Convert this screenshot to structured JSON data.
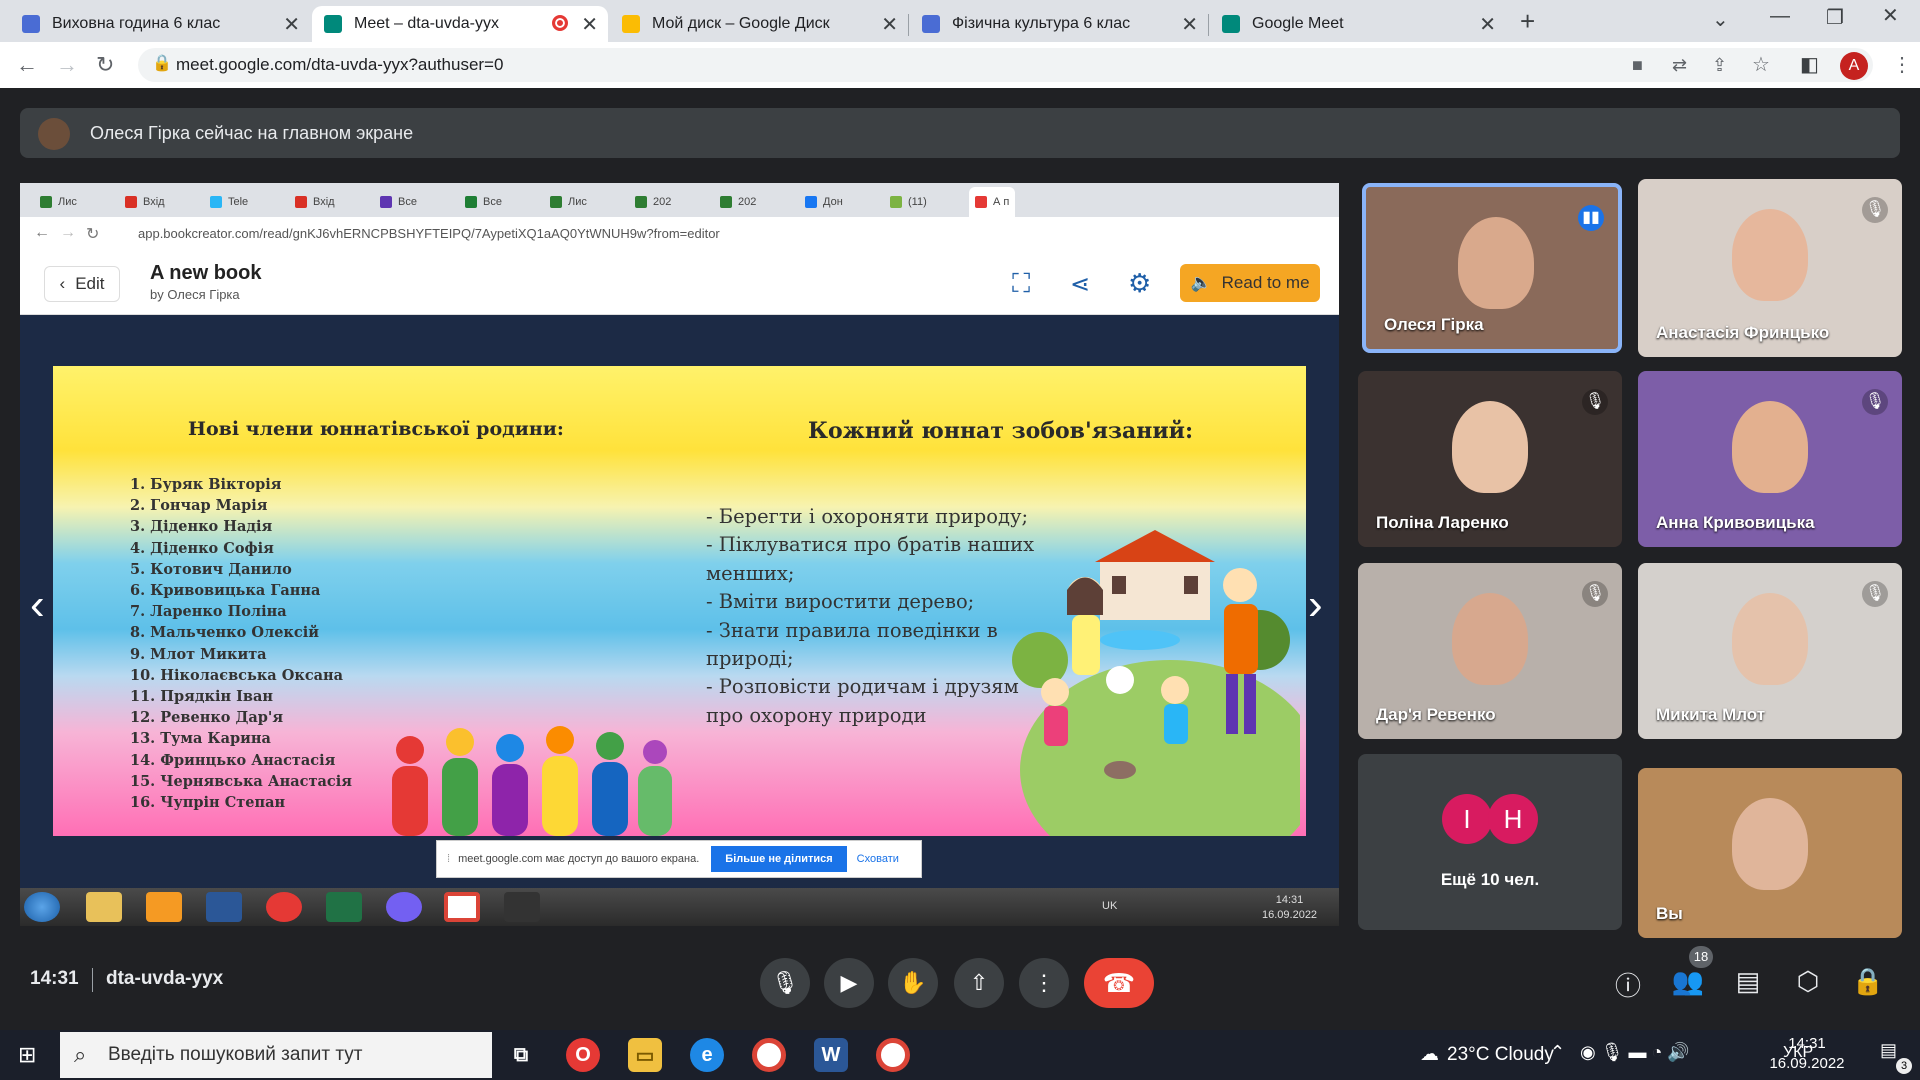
{
  "browser": {
    "tabs": [
      {
        "title": "Виховна година 6 клас",
        "color": "#4a6cd4"
      },
      {
        "title": "Meet – dta-uvda-yyx",
        "color": "#00897b"
      },
      {
        "title": "Мой диск – Google Диск",
        "color": "#fbbc04"
      },
      {
        "title": "Фізична культура 6 клас",
        "color": "#4a6cd4"
      },
      {
        "title": "Google Meet",
        "color": "#00897b"
      }
    ],
    "url": "meet.google.com/dta-uvda-yyx?authuser=0",
    "profile_initial": "A"
  },
  "meet": {
    "banner": "Олеся Гірка сейчас на главном экране",
    "shared": {
      "inner_url": "app.bookcreator.com/read/gnKJ6vhERNCPBSHYFTEIPQ/7AypetiXQ1aAQ0YtWNUH9w?from=editor",
      "inner_tabs": [
        "Лис",
        "Вхід",
        "Tele",
        "Вхід",
        "Всe",
        "Всe",
        "Лис",
        "202",
        "202",
        "Дон",
        "(11)",
        "А п"
      ],
      "edit_label": "Edit",
      "book_title": "A new book",
      "book_by": "by Олеся Гірка",
      "read_label": "Read to me",
      "slide": {
        "left_title": "Нові члени юннатівської родини:",
        "right_title": "Кожний юннат зобов'язаний:",
        "names": [
          "1.   Буряк Вікторія",
          "2.   Гончар Марія",
          "3.   Діденко Надія",
          "4.   Діденко Софія",
          "5.   Котович Данило",
          "6.   Кривовицька Ганна",
          "7.   Ларенко Поліна",
          "8.   Мальченко Олексій",
          "9.   Млот Микита",
          "10.  Ніколаєвська Оксана",
          "11.  Прядкін Іван",
          "12.  Ревенко Дар'я",
          "13.  Тума Карина",
          "14.  Фринцько Анастасія",
          "15.  Чернявська Анастасія",
          "16.  Чупрін Степан"
        ],
        "duties": [
          "- Берегти і охороняти природу;",
          "- Піклуватися про братів наших менших;",
          "- Вміти виростити дерево;",
          "- Знати правила поведінки в природі;",
          "- Розповісти родичам і друзям про охорону природи"
        ]
      },
      "share_notice": "meet.google.com має доступ до вашого екрана.",
      "stop_label": "Більше не ділитися",
      "hide_label": "Сховати",
      "inner_lang": "UK",
      "inner_time": "14:31",
      "inner_date": "16.09.2022"
    },
    "participants": [
      {
        "name": "Олеся Гірка",
        "bg": "#8a6a5a",
        "face": "#d9a98c"
      },
      {
        "name": "Анастасія Фринцько",
        "bg": "#d8cfc8",
        "face": "#e6b79c"
      },
      {
        "name": "Поліна Ларенко",
        "bg": "#3b3230",
        "face": "#e8c2a6"
      },
      {
        "name": "Анна Кривовицька",
        "bg": "#7d5ea8",
        "face": "#e3b08f"
      },
      {
        "name": "Дар'я Ревенко",
        "bg": "#b8b0aa",
        "face": "#d7a88e"
      },
      {
        "name": "Микита Млот",
        "bg": "#d4d0cc",
        "face": "#e5c2ab"
      },
      {
        "name": "Вы",
        "bg": "#b88a5a",
        "face": "#e0b59a"
      }
    ],
    "more": {
      "label": "Ещё 10 чел.",
      "avatars": [
        "I",
        "H"
      ],
      "colors": [
        "#d81b60",
        "#d81b60"
      ]
    },
    "time": "14:31",
    "code": "dta-uvda-yyx",
    "people_count": "18"
  },
  "taskbar": {
    "search_placeholder": "Введіть пошуковий запит тут",
    "weather": "23°C  Cloudy",
    "lang": "УКР",
    "time": "14:31",
    "date": "16.09.2022",
    "notifications": "3"
  }
}
